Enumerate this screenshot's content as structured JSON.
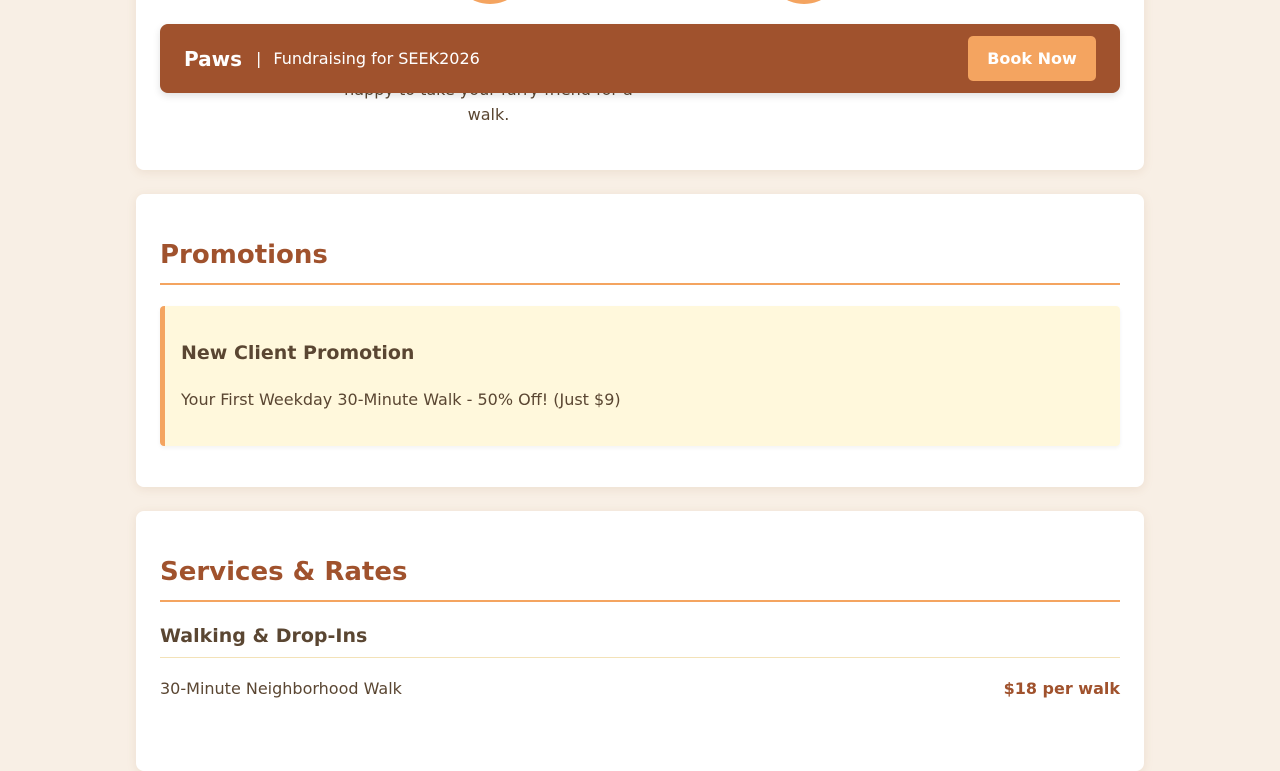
{
  "header": {
    "brand": "Paws",
    "separator": "|",
    "tagline": "Fundraising for SEEK2026",
    "book_label": "Book Now"
  },
  "walker": {
    "description": "happy to take your furry friend for a walk."
  },
  "promotions": {
    "title": "Promotions",
    "items": [
      {
        "title": "New Client Promotion",
        "text": "Your First Weekday 30-Minute Walk - 50% Off! (Just $9)"
      }
    ]
  },
  "services": {
    "title": "Services & Rates",
    "groups": [
      {
        "title": "Walking & Drop-Ins",
        "rows": [
          {
            "name": "30-Minute Neighborhood Walk",
            "price": "$18 per walk"
          }
        ]
      }
    ]
  },
  "colors": {
    "page_bg": "#f8efe5",
    "brand": "#a0522d",
    "accent": "#f4a460",
    "promo_bg": "#fff8dc",
    "text": "#5a4632"
  }
}
